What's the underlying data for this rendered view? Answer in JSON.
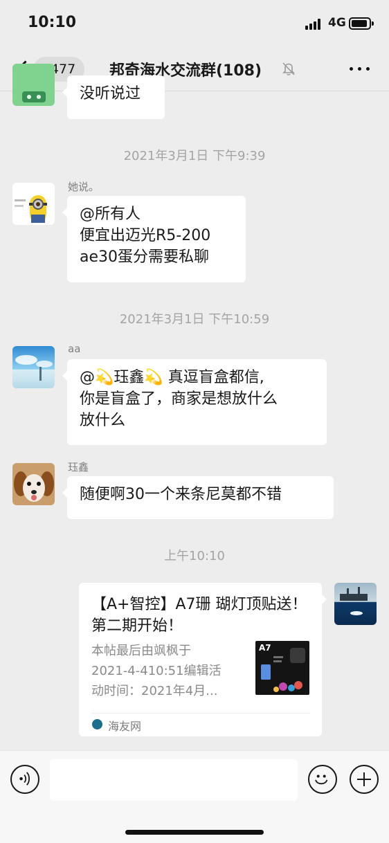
{
  "status_bar": {
    "time": "10:10",
    "network": "4G"
  },
  "nav": {
    "back_count": "3477",
    "title": "邦奇海水交流群(108)"
  },
  "messages": [
    {
      "type": "text",
      "lines": [
        "没听说过"
      ]
    },
    {
      "type": "time",
      "text": "2021年3月1日 下午9:39"
    },
    {
      "type": "text",
      "sender": "她说。",
      "lines": [
        "@所有人",
        "便宜出迈光R5-200",
        "ae30蛋分需要私聊"
      ]
    },
    {
      "type": "time",
      "text": "2021年3月1日 下午10:59"
    },
    {
      "type": "text",
      "sender": "aa",
      "lines": [
        "@💫珏鑫💫 真逗盲盒都信,",
        "你是盲盒了，商家是想放什么",
        "放什么"
      ]
    },
    {
      "type": "text",
      "sender": "珏鑫",
      "lines": [
        "随便啊30一个来条尼莫都不错"
      ]
    },
    {
      "type": "time",
      "text": "上午10:10"
    },
    {
      "type": "link_card",
      "title": "【A+智控】A7珊 瑚灯顶贴送！第二期开始！",
      "description": [
        "本帖最后由飒枫于",
        "2021-4-410:51编辑活",
        "动时间：2021年4月..."
      ],
      "thumb_label": "A7",
      "source": "海友网"
    }
  ],
  "icons": {
    "back": "chevron-left-icon",
    "mute": "bell-off-icon",
    "more": "ellipsis-icon",
    "voice": "voice-icon",
    "emoji": "smiley-icon",
    "plus": "plus-icon",
    "source": "haiyou-logo-icon"
  },
  "colors": {
    "background": "#ededed",
    "bubble": "#ffffff",
    "timestamp": "#a4a4a4"
  }
}
